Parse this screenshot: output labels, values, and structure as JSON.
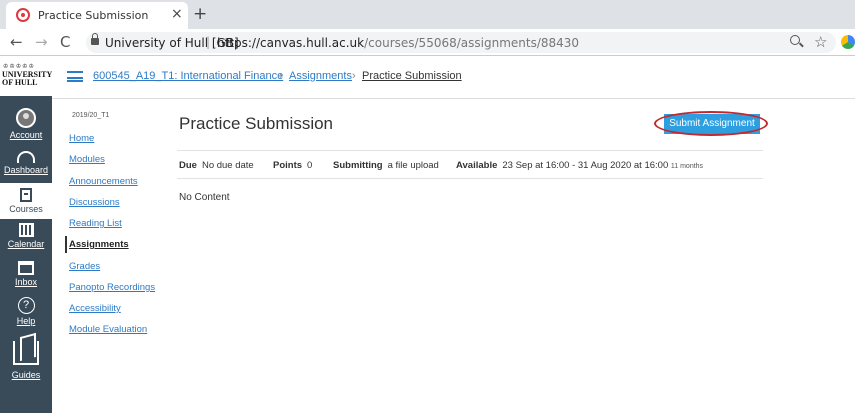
{
  "browser": {
    "tab_title": "Practice Submission",
    "tab_close": "×",
    "new_tab": "+",
    "back": "←",
    "forward": "→",
    "reload": "C",
    "site_identity": "University of Hull [GB]",
    "separator": "|",
    "url_host_part": "https://canvas.hull.ac.uk",
    "url_path_part": "/courses/55068/assignments/88430"
  },
  "global_nav": {
    "logo_crest": "♔♔♔♔♔",
    "logo_line1": "UNIVERSITY",
    "logo_line2": "OF HULL",
    "items": [
      {
        "label": "Account",
        "icon": "avatar-icon"
      },
      {
        "label": "Dashboard",
        "icon": "dashboard-icon"
      },
      {
        "label": "Courses",
        "icon": "courses-icon"
      },
      {
        "label": "Calendar",
        "icon": "calendar-icon"
      },
      {
        "label": "Inbox",
        "icon": "inbox-icon"
      },
      {
        "label": "Help",
        "icon": "help-icon"
      },
      {
        "label": "Guides",
        "icon": "guides-icon"
      }
    ],
    "help_glyph": "?"
  },
  "breadcrumb": {
    "course": "600545_A19_T1: International Finance",
    "section": "Assignments",
    "current": "Practice Submission",
    "sep": "›"
  },
  "course_nav": {
    "term": "2019/20_T1",
    "items": [
      {
        "label": "Home"
      },
      {
        "label": "Modules"
      },
      {
        "label": "Announcements"
      },
      {
        "label": "Discussions"
      },
      {
        "label": "Reading List"
      },
      {
        "label": "Assignments"
      },
      {
        "label": "Grades"
      },
      {
        "label": "Panopto Recordings"
      },
      {
        "label": "Accessibility"
      },
      {
        "label": "Module Evaluation"
      }
    ]
  },
  "assignment": {
    "title": "Practice Submission",
    "submit_label": "Submit Assignment",
    "due_label": "Due",
    "due_value": "No due date",
    "points_label": "Points",
    "points_value": "0",
    "submitting_label": "Submitting",
    "submitting_value": "a file upload",
    "available_label": "Available",
    "available_value": "23 Sep at 16:00 - 31 Aug 2020 at 16:00",
    "available_note": "11 months",
    "body": "No Content"
  },
  "colors": {
    "link": "#2d7bc6",
    "nav_bg": "#394b58",
    "button": "#2d9fe0",
    "highlight_ring": "#c4282c"
  }
}
